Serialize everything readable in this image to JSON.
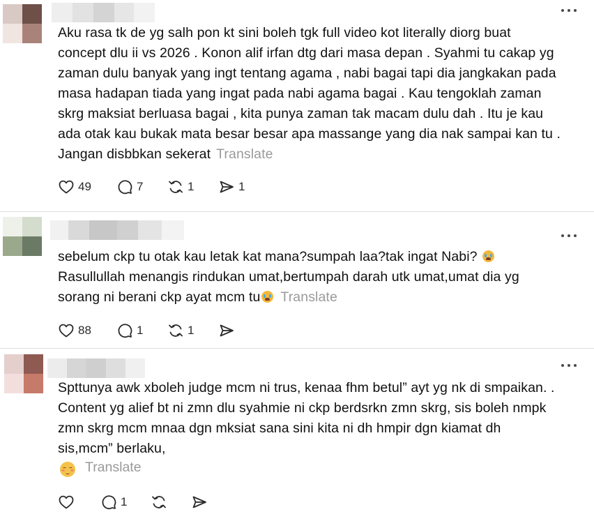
{
  "comments": [
    {
      "body": "Aku rasa tk de yg salh pon kt sini boleh tgk full video kot literally diorg buat\nconcept dlu ii vs 2026 . Konon alif irfan dtg dari masa depan . Syahmi tu cakap yg\nzaman dulu banyak yang ingt tentang agama , nabi bagai tapi dia jangkakan pada\nmasa hadapan tiada yang ingat pada nabi agama bagai . Kau tengoklah zaman\nskrg maksiat berluasa bagai , kita punya zaman tak macam dulu dah . Itu je kau\nada otak kau bukak mata besar besar apa massange yang dia nak sampai kan tu .\nJangan disbbkan sekerat",
      "translate": "Translate",
      "likes": "49",
      "replies": "7",
      "reposts": "1",
      "shares": "1"
    },
    {
      "line1": "sebelum ckp tu otak kau letak kat mana?sumpah laa?tak ingat Nabi?",
      "line2": "Rasullullah menangis rindukan umat,bertumpah darah utk umat,umat dia yg",
      "line3": "sorang ni berani ckp ayat mcm tu",
      "translate": "Translate",
      "likes": "88",
      "replies": "1",
      "reposts": "1"
    },
    {
      "body": "Spttunya awk xboleh judge mcm ni trus, kenaa fhm betul” ayt yg nk di smpaikan. .\nContent yg alief bt ni zmn dlu syahmie ni ckp berdsrkn zmn skrg, sis boleh nmpk\nzmn skrg mcm mnaa dgn mksiat sana sini kita ni dh hmpir dgn kiamat dh\nsis,mcm” berlaku,",
      "translate": "Translate",
      "replies": "1"
    }
  ],
  "icons": {
    "like": "heart-icon",
    "reply": "comment-icon",
    "repost": "repost-icon",
    "share": "share-icon",
    "more": "more-dots-icon",
    "emoji_cry": "loudly-crying-face-emoji",
    "emoji_relieved": "relieved-face-emoji"
  },
  "colors": {
    "text": "#101010",
    "muted": "#9a9a9a",
    "divider": "#dedede",
    "icon": "#2a2a2a"
  }
}
